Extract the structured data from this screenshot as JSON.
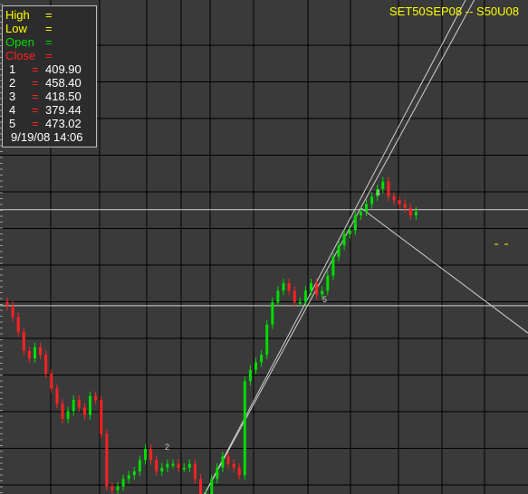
{
  "title": "SET50SEP08  --  S50U08",
  "colors": {
    "background": "#3a3a3a",
    "grid": "#000000",
    "up": "#00dd00",
    "down": "#ff2222",
    "title": "#ffff00"
  },
  "info": {
    "high_label": "High",
    "low_label": "Low",
    "open_label": "Open",
    "close_label": "Close",
    "eq": "=",
    "points": [
      {
        "label": "1",
        "value": "409.90"
      },
      {
        "label": "2",
        "value": "458.40"
      },
      {
        "label": "3",
        "value": "418.50"
      },
      {
        "label": "4",
        "value": "379.44"
      },
      {
        "label": "5",
        "value": "473.02"
      }
    ],
    "datetime": "9/19/08  14:06"
  },
  "chart_data": {
    "type": "candlestick",
    "price_range": [
      360,
      490
    ],
    "candles_close": [
      410,
      407,
      403,
      398,
      396,
      399,
      397,
      392,
      388,
      384,
      380,
      382,
      385,
      383,
      381,
      386,
      385,
      376,
      362,
      361,
      362,
      364,
      365,
      366,
      369,
      372,
      369,
      366,
      367,
      368,
      368,
      367,
      367,
      368,
      364,
      359,
      360,
      364,
      367,
      370,
      368,
      367,
      365,
      390,
      393,
      395,
      397,
      405,
      411,
      414,
      416,
      414,
      411,
      411,
      414,
      416,
      413,
      414,
      418,
      423,
      426,
      429,
      430,
      434,
      435,
      437,
      439,
      441,
      443,
      439,
      438,
      437,
      436,
      434,
      435
    ],
    "markers": [
      {
        "label": "2",
        "index": 35
      },
      {
        "label": "4",
        "index": 64
      },
      {
        "label": "5",
        "index": 53
      }
    ]
  }
}
